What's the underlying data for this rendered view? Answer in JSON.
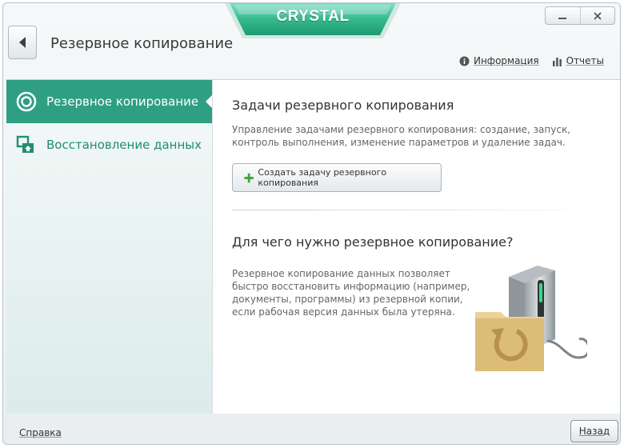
{
  "window": {
    "brand": "CRYSTAL",
    "title": "Резервное копирование",
    "controls": {
      "minimize_icon": "minimize-icon",
      "close_icon": "close-icon"
    },
    "top_links": {
      "info": {
        "label": "Информация",
        "icon": "info-icon"
      },
      "reports": {
        "label": "Отчеты",
        "icon": "bar-chart-icon"
      }
    }
  },
  "sidebar": {
    "items": [
      {
        "label": "Резервное копирование",
        "icon": "backup-icon",
        "active": true
      },
      {
        "label": "Восстановление данных",
        "icon": "restore-icon",
        "active": false
      }
    ]
  },
  "main": {
    "tasks_title": "Задачи резервного копирования",
    "tasks_description": "Управление задачами резервного копирования: создание, запуск, контроль выполнения, изменение параметров и удаление задач.",
    "create_button": "Создать задачу резервного копирования",
    "why_title": "Для чего нужно резервное копирование?",
    "why_description": "Резервное копирование данных позволяет быстро восстановить информацию (например, документы, программы) из резервной копии, если рабочая версия данных была утеряна."
  },
  "footer": {
    "help_link": "Справка",
    "back_button": "Назад"
  },
  "colors": {
    "accent": "#2e9f82",
    "accent_text": "#1f8e70",
    "brand_green": "#3cc69c"
  }
}
